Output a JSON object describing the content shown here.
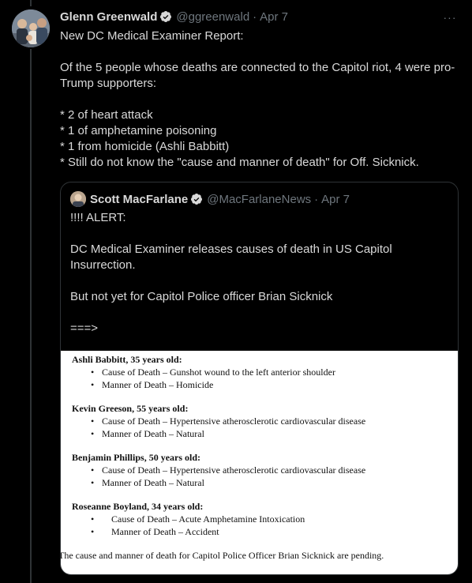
{
  "tweet": {
    "author_name": "Glenn Greenwald",
    "handle": "@ggreenwald",
    "date": "Apr 7",
    "more_label": "···",
    "text": {
      "line1": "New DC Medical Examiner Report:",
      "line2": "Of the 5 people whose deaths are connected to the Capitol riot, 4 were pro-Trump supporters:",
      "bullet1": "* 2 of heart attack",
      "bullet2": "* 1 of amphetamine poisoning",
      "bullet3": "* 1 from homicide (Ashli Babbitt)",
      "bullet4": "* Still do not know the \"cause and manner of death\" for Off. Sicknick."
    }
  },
  "quote": {
    "author_name": "Scott MacFarlane",
    "handle": "@MacFarlaneNews",
    "date": "Apr 7",
    "text": {
      "line1": "!!!! ALERT:",
      "line2": "DC Medical Examiner releases causes of death in US Capitol Insurrection.",
      "line3": "But not yet for Capitol Police officer Brian Sicknick",
      "line4": "===>"
    },
    "document": {
      "persons": [
        {
          "header": "Ashli Babbitt, 35 years old:",
          "cause": "Cause of Death – Gunshot wound to the left anterior shoulder",
          "manner": "Manner of Death – Homicide"
        },
        {
          "header": "Kevin Greeson, 55 years old:",
          "cause": "Cause of Death – Hypertensive atherosclerotic cardiovascular disease",
          "manner": "Manner of Death – Natural"
        },
        {
          "header": "Benjamin Phillips, 50 years old:",
          "cause": "Cause of Death – Hypertensive atherosclerotic cardiovascular disease",
          "manner": "Manner of Death – Natural"
        },
        {
          "header": "Roseanne Boyland, 34 years old:",
          "cause": "Cause of Death – Acute Amphetamine Intoxication",
          "manner": "Manner of Death – Accident"
        }
      ],
      "bullet_glyph": "•",
      "footer": "The cause and manner of death for Capitol Police Officer Brian Sicknick are pending."
    }
  },
  "colors": {
    "background": "#000000",
    "text": "#d9d9d9",
    "muted": "#6e767d",
    "border": "#2f3336",
    "verified": "#8b98a5"
  },
  "icons": {
    "verified": "verified-badge-icon",
    "more": "more-options-icon"
  }
}
